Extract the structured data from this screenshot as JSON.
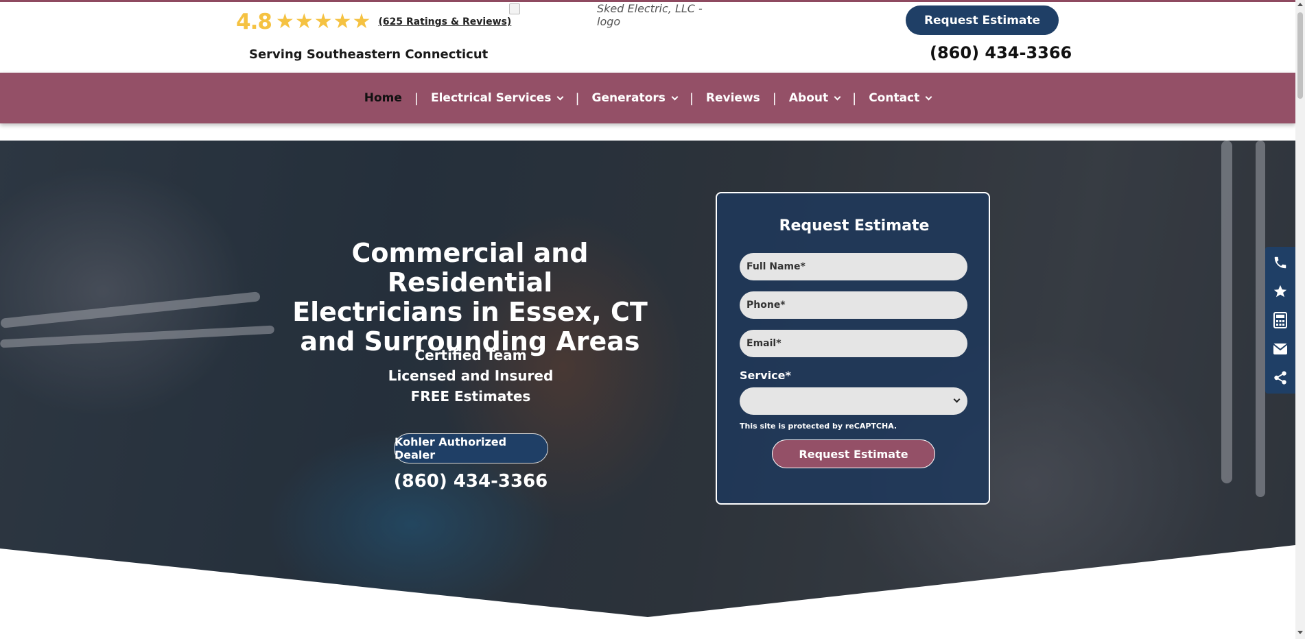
{
  "header": {
    "rating_value": "4.8",
    "rating_stars": 5,
    "ratings_link": "(625 Ratings & Reviews)",
    "serving": "Serving Southeastern Connecticut",
    "logo_alt": "Sked Electric, LLC - logo",
    "request_button": "Request Estimate",
    "phone": "(860) 434-3366"
  },
  "nav": {
    "items": [
      {
        "label": "Home",
        "dropdown": false
      },
      {
        "label": "Electrical Services",
        "dropdown": true
      },
      {
        "label": "Generators",
        "dropdown": true
      },
      {
        "label": "Reviews",
        "dropdown": false
      },
      {
        "label": "About",
        "dropdown": true
      },
      {
        "label": "Contact",
        "dropdown": true
      }
    ],
    "separator": "|"
  },
  "hero": {
    "title_line1": "Commercial and Residential",
    "title_line2": "Electricians in Essex, CT",
    "title_line3": "and Surrounding Areas",
    "sub_line1": "Certified Team",
    "sub_line2": "Licensed and Insured",
    "sub_line3": "FREE Estimates",
    "dealer_button": "Kohler Authorized Dealer",
    "phone": "(860) 434-3366"
  },
  "form": {
    "title": "Request Estimate",
    "name_placeholder": "Full Name*",
    "phone_placeholder": "Phone*",
    "email_placeholder": "Email*",
    "service_label": "Service*",
    "service_value": "",
    "recaptcha_note": "This site is protected by reCAPTCHA.",
    "submit_label": "Request Estimate"
  },
  "side_toolbar": {
    "icons": [
      "phone-icon",
      "star-icon",
      "calculator-icon",
      "envelope-icon",
      "share-icon"
    ]
  },
  "colors": {
    "brand_maroon": "#945067",
    "brand_navy": "#1f3f66",
    "star_gold": "#f5c242"
  }
}
